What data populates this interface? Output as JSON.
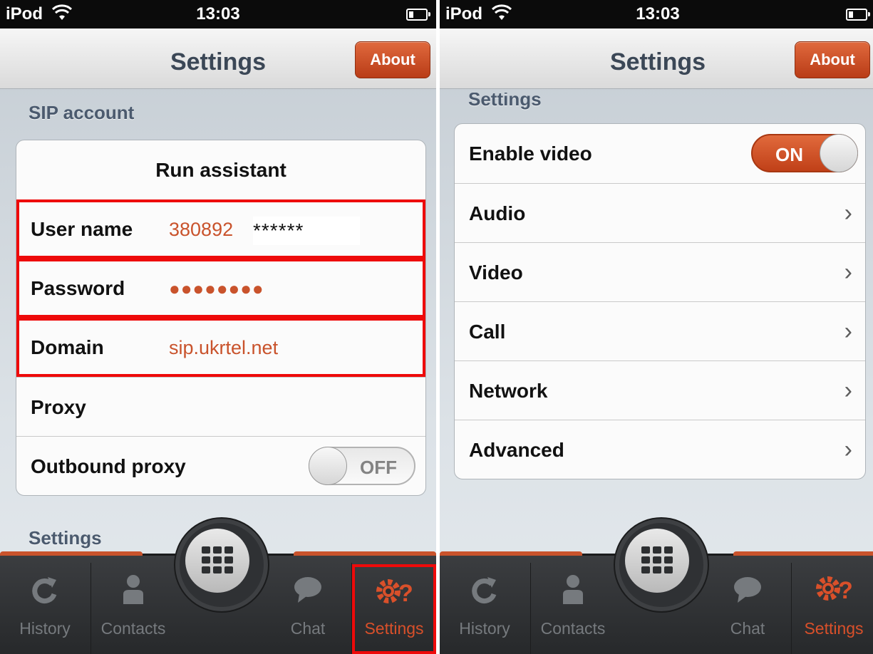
{
  "status_bar": {
    "carrier": "iPod",
    "wifi_icon": "wifi-icon",
    "time": "13:03",
    "battery_icon": "battery-icon"
  },
  "left": {
    "nav": {
      "title": "Settings",
      "about": "About"
    },
    "sip_section": "SIP account",
    "rows": {
      "run_assistant": "Run assistant",
      "user_name_label": "User name",
      "user_name_value": "380892",
      "user_name_masked": "******",
      "password_label": "Password",
      "password_value": "●●●●●●●●",
      "domain_label": "Domain",
      "domain_value": "sip.ukrtel.net",
      "proxy_label": "Proxy",
      "outbound_label": "Outbound proxy",
      "outbound_toggle": "OFF"
    },
    "settings_section": "Settings"
  },
  "right": {
    "nav": {
      "title": "Settings",
      "about": "About"
    },
    "settings_section": "Settings",
    "rows": {
      "enable_video": "Enable video",
      "enable_video_toggle": "ON",
      "audio": "Audio",
      "video": "Video",
      "call": "Call",
      "network": "Network",
      "advanced": "Advanced"
    }
  },
  "tabs": {
    "history": "History",
    "contacts": "Contacts",
    "chat": "Chat",
    "settings": "Settings"
  },
  "colors": {
    "accent": "#c9532c",
    "highlight": "#ee0a0a"
  }
}
